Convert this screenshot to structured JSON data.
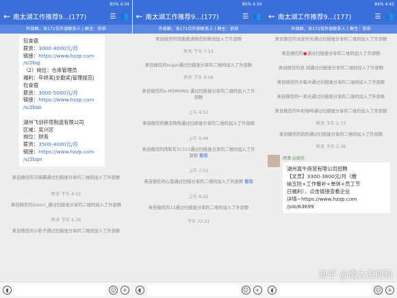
{
  "status": {
    "p1": {
      "left": "",
      "right": "85% 4:34"
    },
    "p2": {
      "left": "",
      "right": "85% 4:34"
    },
    "p3": {
      "left": "",
      "right": "84% 4:42"
    }
  },
  "header": {
    "title": "南太湖工作推荐9...(177)",
    "title3": "南太湖工作推荐9...(177)"
  },
  "notice": {
    "p1": "外部群，含171位外部联系人 | 群主：依依",
    "p2": "外部群，含171位外部联系人 | 群主：依依",
    "p3": "外部群，含172位外部联系人 | 群主：依依"
  },
  "p1": {
    "bubble": [
      {
        "t": "包食宿",
        "k": "n"
      },
      {
        "t": "薪资：3000-4000元/月",
        "k": "m"
      },
      {
        "t": "链接：https://www.hzzp.com",
        "k": "l"
      },
      {
        "t": "/s/2bqj",
        "k": "lk"
      },
      {
        "t": "（2）岗位：仓库管理员",
        "k": "n"
      },
      {
        "t": "福利：年终奖|全勤奖|管理规范|",
        "k": "n"
      },
      {
        "t": "包食宿",
        "k": "n"
      },
      {
        "t": "薪资：3000-5000元/月",
        "k": "m"
      },
      {
        "t": "链接：https://www.hzzp.com",
        "k": "l"
      },
      {
        "t": "/s/2bqk",
        "k": "lk"
      },
      {
        "t": "",
        "k": "n"
      },
      {
        "t": "湖州飞剑杆塔制造有限公司",
        "k": "n"
      },
      {
        "t": "区域：吴兴区",
        "k": "n"
      },
      {
        "t": "岗位：财务",
        "k": "n"
      },
      {
        "t": "薪资：3500-4000元/月",
        "k": "m"
      },
      {
        "t": "链接：https://www.hzzp.com",
        "k": "l"
      },
      {
        "t": "/s/2bqn",
        "k": "lk"
      }
    ],
    "sys1": "来自微信的马晓晨通过扫描谁分享的二维码加入了外部群",
    "time1": "昨天 下午 4:31",
    "sys2": "来自微信的Gaocc_通过扫描谁分享的二维码加入了外部群",
    "time2": "昨天 下午 4:38",
    "sys3": "来自微信的小影子通过扫描谁分享的二维码加入了外部群"
  },
  "p2": {
    "sys0": "来自微信的馆能邀请微信的桐浅加入了外部群",
    "time1": "昨天 下午 7:13",
    "sys1": "来自微信的sugar通过扫描谁分享的二维码加入了外部群",
    "time2": "昨天 下午 9:08",
    "sys2": "来自微信的a MORNING 通过扫描谁分享的二维码加入了外部群",
    "time3": "上午 4:52",
    "sys3": "来自微信的槿凉殇殇通过扫描谁分享的二维码加入了外部群",
    "time4": "上午 6:44",
    "sys4a": "来自微信的闹和军31313通过扫描谁分享的二维码加入了外部群 ",
    "sys4b": "撤销",
    "time5": "上午 7:51",
    "sys5a": "来自微信的心翡通过扫描分享的二维码加入了外部群 ",
    "sys5b": "撤销",
    "time6": "上午 8:32",
    "sys6": "来自微信的11通过扫描谁分享的二维码加入了外部群",
    "time7": "下午 12:31"
  },
  "p3": {
    "sys0": "来自微信的淡安时光通过扫描谁分享的二维码加入了外部群",
    "sys1a": "来自微信的",
    "sys1b": "通过扫描谁分享的二维码加入了外部群",
    "sys2": "来自微信的浪 涧通过扫描谁分享的二维码加入了外部群",
    "sys3": "来自微信的今狐冲通过扫描谁分享的二维码加入了外部群",
    "sys4": "来自微信的一束光通过扫描谁分享的二维码加入了外部群",
    "sys5": "来自微信的牛奶咖啡通过扫描谁分享的二维码加入了外部群",
    "time1": "昨天 下午 2:33",
    "sys6": "来自微信的阳阳通过扫描谁分享的二维码加入了外部群",
    "time2": "昨天 下午 2:38",
    "ad_name": "雨潇 @微信",
    "ad_lines": [
      {
        "t": "湖州真牛商贸有限公司招聘",
        "k": "n"
      },
      {
        "t": "【文员】3300-3800元/月（缴",
        "k": "n"
      },
      {
        "t": "纳五险+工作餐补+单休+员工节",
        "k": "n"
      },
      {
        "t": "日福利），点击链接查看企业",
        "k": "n"
      },
      {
        "t": "详情~https://www.hzzp.com",
        "k": "n"
      },
      {
        "t": "/job/63699",
        "k": "lk"
      }
    ]
  },
  "watermark": "知乎 @南太湖斯新"
}
